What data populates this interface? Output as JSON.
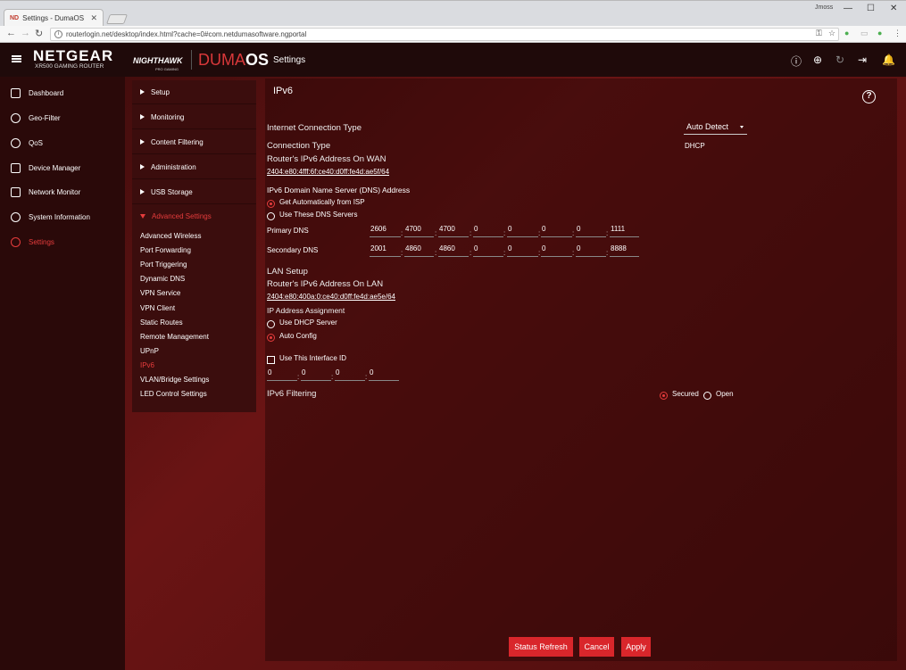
{
  "browser": {
    "tab_title": "Settings - DumaOS",
    "favicon_text": "ND",
    "user_label": "Jmoss",
    "url": "routerlogin.net/desktop/index.html?cache=0#com.netdumasoftware.ngportal"
  },
  "header": {
    "brand": "NETGEAR",
    "model": "XR500 GAMING ROUTER",
    "nighthawk": "NIGHTHAWK",
    "nighthawk_sub": "PRO GAMING",
    "duma_prefix": "DUMA",
    "duma_suffix": "OS",
    "page_title": "Settings"
  },
  "leftnav": {
    "items": [
      {
        "label": "Dashboard",
        "icon": "dashboard-icon"
      },
      {
        "label": "Geo-Filter",
        "icon": "geo-filter-icon"
      },
      {
        "label": "QoS",
        "icon": "qos-icon"
      },
      {
        "label": "Device Manager",
        "icon": "device-manager-icon"
      },
      {
        "label": "Network Monitor",
        "icon": "network-monitor-icon"
      },
      {
        "label": "System Information",
        "icon": "system-information-icon"
      },
      {
        "label": "Settings",
        "icon": "settings-icon"
      }
    ],
    "active": "Settings"
  },
  "submenu": {
    "top": [
      "Setup",
      "Monitoring",
      "Content Filtering",
      "Administration",
      "USB Storage",
      "Advanced Settings"
    ],
    "advanced": [
      "Advanced Wireless",
      "Port Forwarding",
      "Port Triggering",
      "Dynamic DNS",
      "VPN Service",
      "VPN Client",
      "Static Routes",
      "Remote Management",
      "UPnP",
      "IPv6",
      "VLAN/Bridge Settings",
      "LED Control Settings"
    ],
    "active": "IPv6"
  },
  "main": {
    "title": "IPv6",
    "internet_connection_type_label": "Internet Connection Type",
    "internet_connection_type_value": "Auto Detect",
    "connection_type_label": "Connection Type",
    "connection_type_value": "DHCP",
    "wan_addr_label": "Router's IPv6 Address On WAN",
    "wan_addr_value": "2404:e80:4fff:6f:ce40:d0ff:fe4d:ae5f/64",
    "dns_heading": "IPv6 Domain Name Server (DNS) Address",
    "dns_option_isp": "Get Automatically from ISP",
    "dns_option_custom": "Use These DNS Servers",
    "dns_selected": "isp",
    "primary_dns_label": "Primary DNS",
    "primary_dns": [
      "2606",
      "4700",
      "4700",
      "0",
      "0",
      "0",
      "0",
      "1111"
    ],
    "secondary_dns_label": "Secondary DNS",
    "secondary_dns": [
      "2001",
      "4860",
      "4860",
      "0",
      "0",
      "0",
      "0",
      "8888"
    ],
    "lan_setup_label": "LAN Setup",
    "lan_addr_label": "Router's IPv6 Address On LAN",
    "lan_addr_value": "2404:e80:400a:0:ce40:d0ff:fe4d:ae5e/64",
    "ip_assign_label": "IP Address Assignment",
    "ip_assign_dhcp": "Use DHCP Server",
    "ip_assign_auto": "Auto Config",
    "ip_assign_selected": "auto",
    "interface_id_label": "Use This Interface ID",
    "interface_id_checked": false,
    "interface_id": [
      "0",
      "0",
      "0",
      "0"
    ],
    "filtering_label": "IPv6 Filtering",
    "filtering_secured": "Secured",
    "filtering_open": "Open",
    "filtering_selected": "secured"
  },
  "buttons": {
    "status_refresh": "Status Refresh",
    "cancel": "Cancel",
    "apply": "Apply"
  },
  "colors": {
    "accent": "#d9262b",
    "active_text": "#e63c3c"
  }
}
